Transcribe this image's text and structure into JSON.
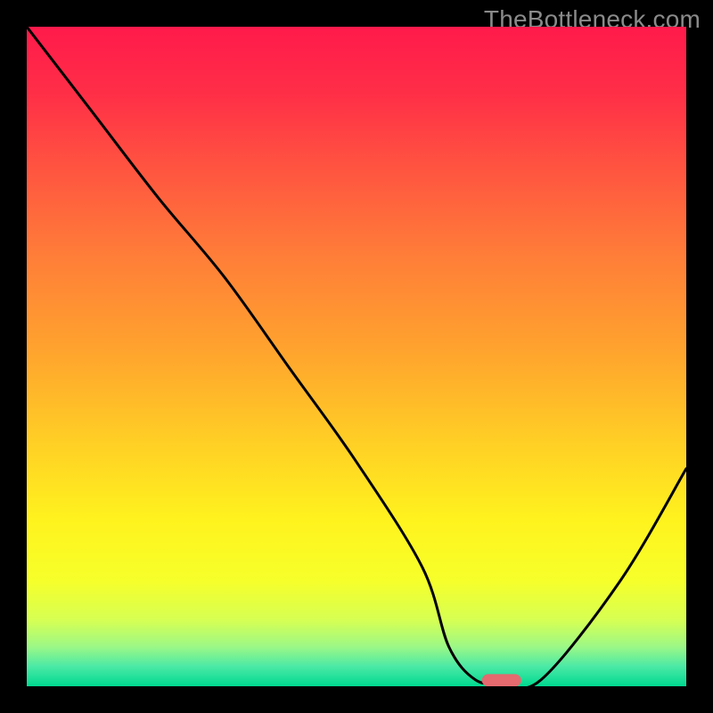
{
  "watermark": "TheBottleneck.com",
  "chart_data": {
    "type": "line",
    "title": "",
    "xlabel": "",
    "ylabel": "",
    "xlim": [
      0,
      100
    ],
    "ylim": [
      0,
      100
    ],
    "grid": false,
    "series": [
      {
        "name": "curve",
        "x": [
          0,
          10,
          20,
          30,
          40,
          50,
          60,
          64,
          68,
          72,
          78,
          90,
          100
        ],
        "y": [
          100,
          87,
          74,
          62,
          48,
          34,
          18,
          6,
          1,
          0.5,
          1,
          16,
          33
        ]
      }
    ],
    "marker": {
      "x": 72,
      "y": 0.9,
      "color": "#e46a6f"
    },
    "gradient_stops": [
      {
        "offset": 0.0,
        "color": "#ff1a4b"
      },
      {
        "offset": 0.1,
        "color": "#ff2e47"
      },
      {
        "offset": 0.22,
        "color": "#ff5640"
      },
      {
        "offset": 0.35,
        "color": "#ff7e38"
      },
      {
        "offset": 0.5,
        "color": "#ffa62d"
      },
      {
        "offset": 0.63,
        "color": "#ffcf25"
      },
      {
        "offset": 0.75,
        "color": "#fff31e"
      },
      {
        "offset": 0.84,
        "color": "#f6ff2a"
      },
      {
        "offset": 0.9,
        "color": "#d6ff53"
      },
      {
        "offset": 0.94,
        "color": "#9cf886"
      },
      {
        "offset": 0.97,
        "color": "#4be9a6"
      },
      {
        "offset": 1.0,
        "color": "#00d990"
      }
    ]
  }
}
